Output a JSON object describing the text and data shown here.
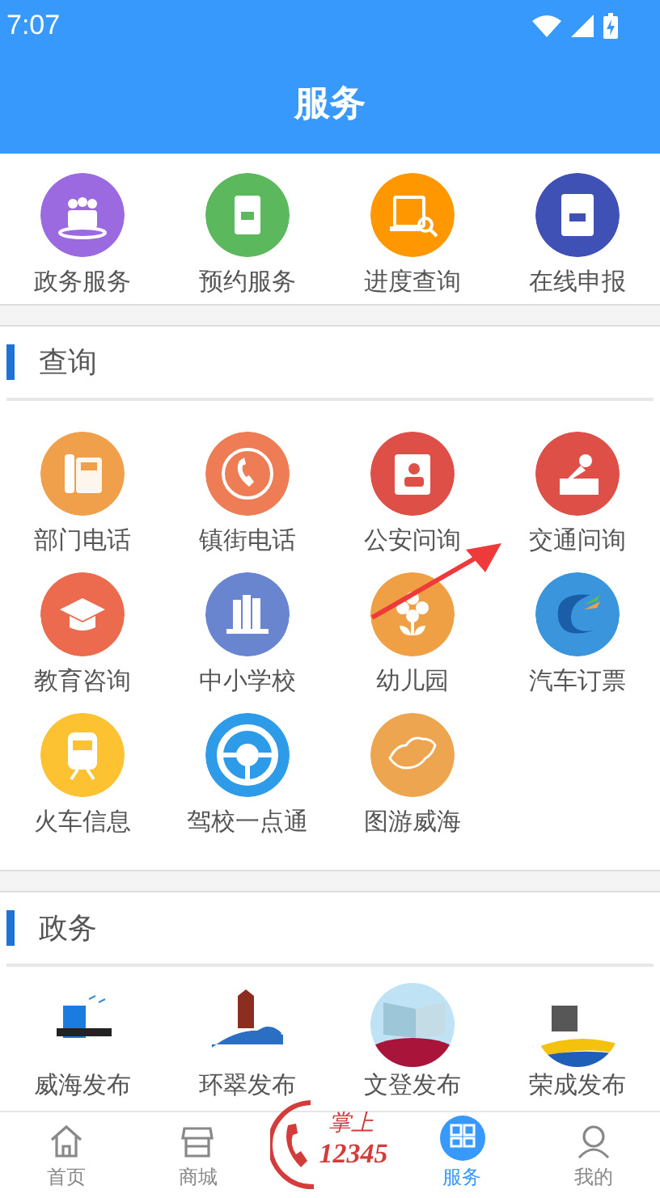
{
  "status_bar": {
    "time": "7:07"
  },
  "title": "服务",
  "top_services": [
    {
      "label": "政务服务",
      "color": "#9c6ae0"
    },
    {
      "label": "预约服务",
      "color": "#5cb85c"
    },
    {
      "label": "进度查询",
      "color": "#ff9800"
    },
    {
      "label": "在线申报",
      "color": "#3f51b5"
    }
  ],
  "sections": [
    {
      "title": "查询",
      "items": [
        {
          "label": "部门电话",
          "color": "#f0a04b",
          "kind": "icon"
        },
        {
          "label": "镇街电话",
          "color": "#ee7d55",
          "kind": "icon"
        },
        {
          "label": "公安问询",
          "color": "#de4f48",
          "kind": "icon"
        },
        {
          "label": "交通问询",
          "color": "#de4f48",
          "kind": "icon"
        },
        {
          "label": "教育咨询",
          "color": "#ec6b4e",
          "kind": "icon"
        },
        {
          "label": "中小学校",
          "color": "#6a85cf",
          "kind": "icon"
        },
        {
          "label": "幼儿园",
          "color": "#f0a044",
          "kind": "icon"
        },
        {
          "label": "汽车订票",
          "color": "#3a95dd",
          "kind": "icon"
        },
        {
          "label": "火车信息",
          "color": "#fcc231",
          "kind": "icon"
        },
        {
          "label": "驾校一点通",
          "color": "#2e9be8",
          "kind": "icon"
        },
        {
          "label": "图游威海",
          "color": "#eda550",
          "kind": "icon"
        }
      ]
    },
    {
      "title": "政务",
      "items": [
        {
          "label": "威海发布",
          "kind": "picture"
        },
        {
          "label": "环翠发布",
          "kind": "picture"
        },
        {
          "label": "文登发布",
          "kind": "picture"
        },
        {
          "label": "荣成发布",
          "kind": "picture"
        }
      ]
    }
  ],
  "bottom_nav": [
    {
      "label": "首页",
      "kind": "tab",
      "selected": false
    },
    {
      "label": "商城",
      "kind": "tab",
      "selected": false
    },
    {
      "label": "掌上",
      "sub": "12345",
      "kind": "logo"
    },
    {
      "label": "服务",
      "kind": "tab",
      "selected": true
    },
    {
      "label": "我的",
      "kind": "tab",
      "selected": false
    }
  ]
}
